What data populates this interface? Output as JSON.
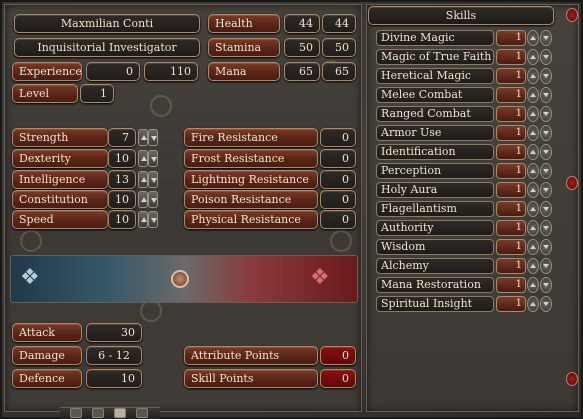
{
  "character": {
    "name": "Maxmilian Conti",
    "class": "Inquisitorial Investigator",
    "experience_label": "Experience",
    "experience_value": "0",
    "experience_next": "110",
    "level_label": "Level",
    "level_value": "1"
  },
  "vitals": [
    {
      "label": "Health",
      "current": "44",
      "max": "44"
    },
    {
      "label": "Stamina",
      "current": "50",
      "max": "50"
    },
    {
      "label": "Mana",
      "current": "65",
      "max": "65"
    }
  ],
  "attributes": [
    {
      "label": "Strength",
      "value": "7"
    },
    {
      "label": "Dexterity",
      "value": "10"
    },
    {
      "label": "Intelligence",
      "value": "13"
    },
    {
      "label": "Constitution",
      "value": "10"
    },
    {
      "label": "Speed",
      "value": "10"
    }
  ],
  "resistances": [
    {
      "label": "Fire Resistance",
      "value": "0"
    },
    {
      "label": "Frost Resistance",
      "value": "0"
    },
    {
      "label": "Lightning Resistance",
      "value": "0"
    },
    {
      "label": "Poison Resistance",
      "value": "0"
    },
    {
      "label": "Physical Resistance",
      "value": "0"
    }
  ],
  "combat": [
    {
      "label": "Attack",
      "value": "30"
    },
    {
      "label": "Damage",
      "value": "6 - 12"
    },
    {
      "label": "Defence",
      "value": "10"
    }
  ],
  "points": [
    {
      "label": "Attribute Points",
      "value": "0"
    },
    {
      "label": "Skill Points",
      "value": "0"
    }
  ],
  "skills": {
    "title": "Skills",
    "items": [
      {
        "label": "Divine Magic",
        "value": "1"
      },
      {
        "label": "Magic of True Faith",
        "value": "1"
      },
      {
        "label": "Heretical Magic",
        "value": "1"
      },
      {
        "label": "Melee Combat",
        "value": "1"
      },
      {
        "label": "Ranged Combat",
        "value": "1"
      },
      {
        "label": "Armor Use",
        "value": "1"
      },
      {
        "label": "Identification",
        "value": "1"
      },
      {
        "label": "Perception",
        "value": "1"
      },
      {
        "label": "Holy Aura",
        "value": "1"
      },
      {
        "label": "Flagellantism",
        "value": "1"
      },
      {
        "label": "Authority",
        "value": "1"
      },
      {
        "label": "Wisdom",
        "value": "1"
      },
      {
        "label": "Alchemy",
        "value": "1"
      },
      {
        "label": "Mana Restoration",
        "value": "1"
      },
      {
        "label": "Spiritual Insight",
        "value": "1"
      }
    ]
  },
  "colors": {
    "plate_red": "#5c2618",
    "plate_dark": "#201d1b",
    "value_red": "#8a1010",
    "border_gold": "#a88a66",
    "text": "#f0e4cc"
  }
}
